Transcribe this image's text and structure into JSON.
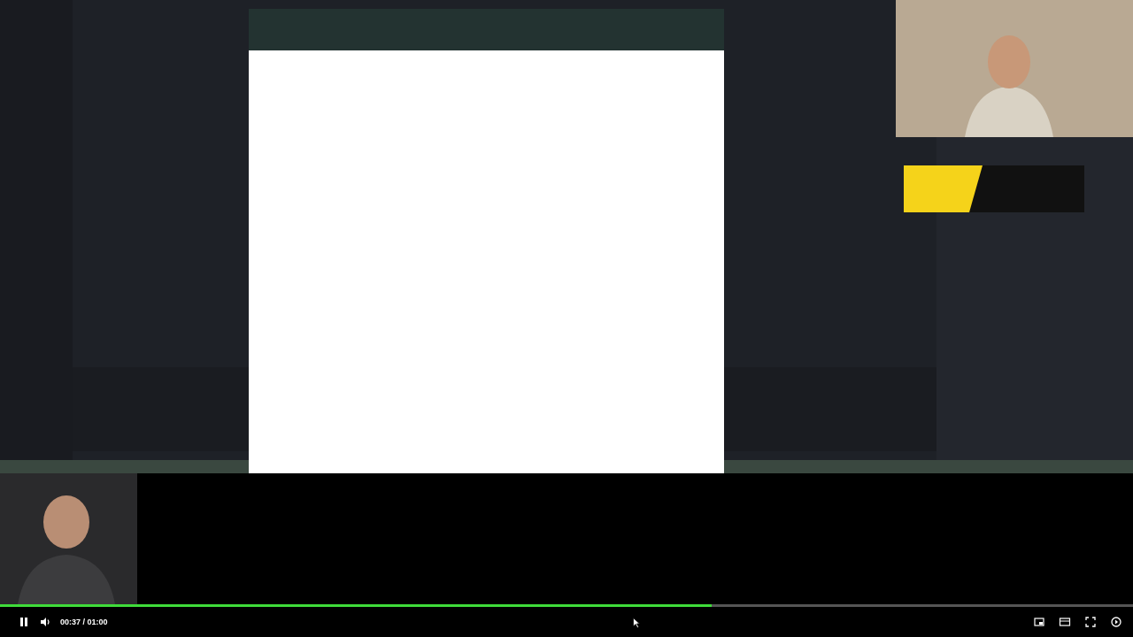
{
  "player": {
    "playing": true,
    "time": "00:37 / 01:00",
    "level": 0.628
  }
}
